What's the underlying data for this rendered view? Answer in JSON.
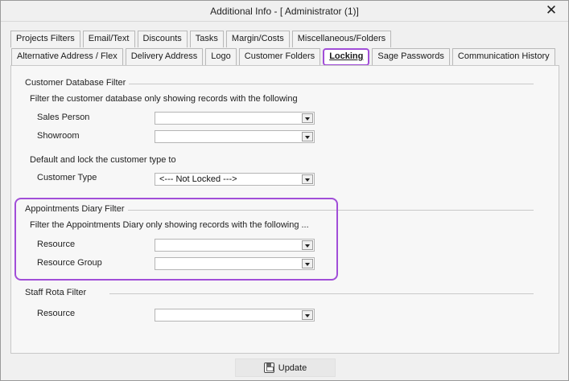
{
  "window": {
    "title": "Additional Info - [ Administrator (1)]",
    "close_glyph": "✕"
  },
  "tabs_row1": [
    {
      "label": "Projects Filters"
    },
    {
      "label": "Email/Text"
    },
    {
      "label": "Discounts"
    },
    {
      "label": "Tasks"
    },
    {
      "label": "Margin/Costs"
    },
    {
      "label": "Miscellaneous/Folders"
    }
  ],
  "tabs_row2": [
    {
      "label": "Alternative Address / Flex"
    },
    {
      "label": "Delivery Address"
    },
    {
      "label": "Logo"
    },
    {
      "label": "Customer Folders"
    },
    {
      "label": "Locking",
      "active": true
    },
    {
      "label": "Sage Passwords"
    },
    {
      "label": "Communication History"
    }
  ],
  "customer_filter": {
    "group_title": "Customer Database Filter",
    "caption": "Filter the customer database only showing records with the following",
    "sales_person_label": "Sales Person",
    "sales_person_value": "",
    "showroom_label": "Showroom",
    "showroom_value": "",
    "lock_caption": "Default and lock the customer type to",
    "customer_type_label": "Customer Type",
    "customer_type_value": "<--- Not Locked --->"
  },
  "diary_filter": {
    "group_title": "Appointments Diary Filter",
    "caption": "Filter the Appointments Diary only showing records with the following ...",
    "resource_label": "Resource",
    "resource_value": "",
    "resource_group_label": "Resource Group",
    "resource_group_value": ""
  },
  "staff_filter": {
    "group_title": "Staff Rota Filter",
    "resource_label": "Resource",
    "resource_value": ""
  },
  "footer": {
    "update_label": "Update"
  },
  "colors": {
    "highlight": "#a14ed8",
    "window_bg": "#f0f0f0",
    "panel_bg": "#f7f7f7"
  },
  "icons": {
    "close": "close-icon",
    "save": "floppy-disk-icon",
    "dropdown": "chevron-down-icon"
  }
}
